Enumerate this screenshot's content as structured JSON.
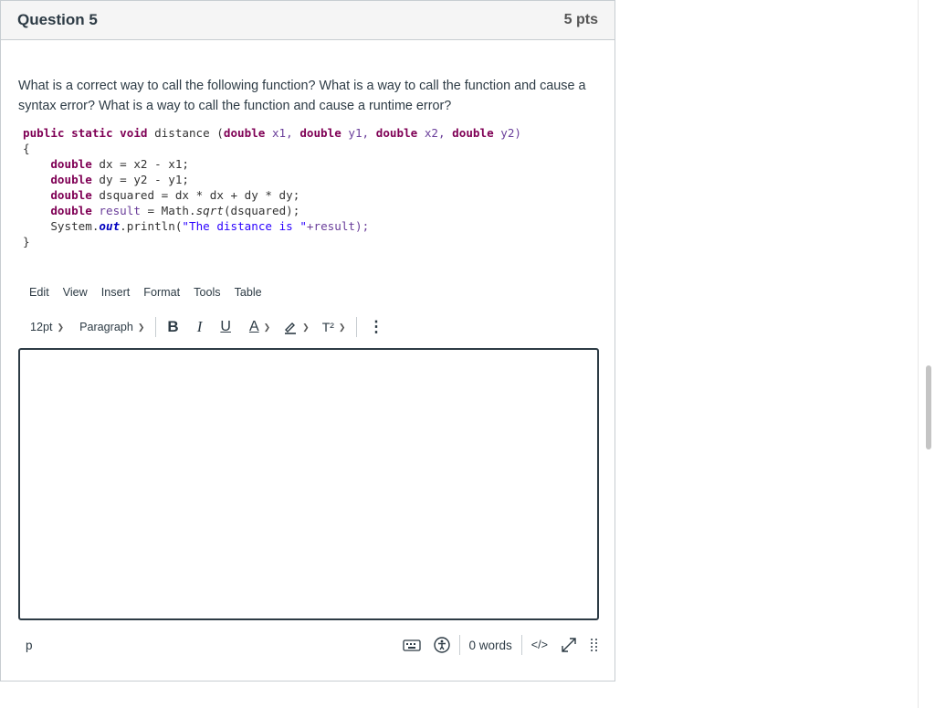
{
  "question": {
    "title": "Question 5",
    "points": "5 pts",
    "text": "What is a correct way to call the following function? What is a way to call the function and cause a syntax error? What is a way to call the function and cause a runtime error?"
  },
  "code": {
    "signature": {
      "kw1": "public static void",
      "name": " distance (",
      "t1": "double",
      "p1": " x1, ",
      "t2": "double",
      "p2": " y1, ",
      "t3": "double",
      "p3": " x2, ",
      "t4": "double",
      "p4": " y2)"
    },
    "open_brace": "{",
    "lines": [
      {
        "type": "double",
        "rest": " dx = x2 - x1;"
      },
      {
        "type": "double",
        "rest": " dy = y2 - y1;"
      },
      {
        "type": "double",
        "rest": " dsquared = dx * dx + dy * dy;"
      },
      {
        "type": "double",
        "rest_var": " result",
        "rest": " = Math.",
        "method": "sqrt",
        "tail": "(dsquared);"
      }
    ],
    "println": {
      "cls": "System.",
      "out": "out",
      "call": ".println(",
      "str": "\"The distance is \"",
      "tail": "+result);"
    },
    "close_brace": "}"
  },
  "menubar": [
    "Edit",
    "View",
    "Insert",
    "Format",
    "Tools",
    "Table"
  ],
  "toolbar": {
    "font_size": "12pt",
    "block_format": "Paragraph",
    "bold": "B",
    "italic": "I",
    "underline": "U",
    "text_color": "A",
    "superscript": "T²",
    "more": "⋮"
  },
  "editor": {
    "content": ""
  },
  "statusbar": {
    "path": "p",
    "word_count": "0 words",
    "html_toggle": "</>"
  },
  "colors": {
    "keyword": "#7f0055",
    "string": "#2a00ff",
    "field": "#0000c0",
    "border": "#c7cdd1",
    "header_bg": "#f5f5f5",
    "text": "#2d3b45"
  }
}
